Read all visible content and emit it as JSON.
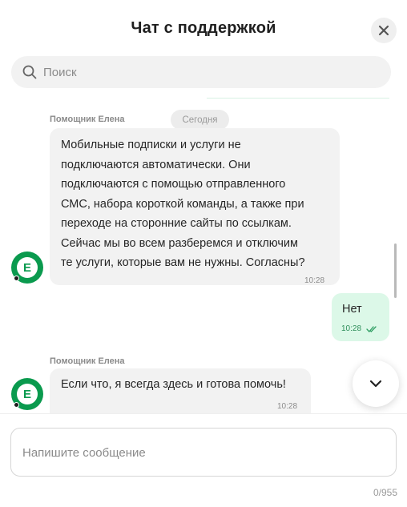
{
  "header": {
    "title": "Чат с поддержкой",
    "close_icon": "close-icon"
  },
  "search": {
    "placeholder": "Поиск",
    "value": ""
  },
  "messages": [
    {
      "direction": "incoming",
      "sender": "Помощник Елена",
      "date_chip": "Сегодня",
      "text": "Мобильные подписки и услуги не\nподключаются автоматически. Они\nподключаются с помощью отправленного\nСМС, набора короткой команды, а также при\nпереходе на сторонние сайты по ссылкам.\nСейчас мы во всем разберемся и отключим\nте услуги, которые вам не нужны. Согласны?",
      "time": "10:28",
      "avatar_letter": "E"
    },
    {
      "direction": "outgoing",
      "text": "Нет",
      "time": "10:28",
      "status_icon": "double-check-icon"
    },
    {
      "direction": "incoming",
      "sender": "Помощник Елена",
      "text": "Если что, я всегда здесь и готова помочь!",
      "time": "10:28",
      "avatar_letter": "E"
    }
  ],
  "composer": {
    "placeholder": "Напишите сообщение",
    "value": "",
    "counter": "0/955"
  },
  "colors": {
    "accent": "#0a9a4e",
    "outgoing_bubble": "#dcf8e8",
    "incoming_bubble": "#f2f2f2"
  }
}
